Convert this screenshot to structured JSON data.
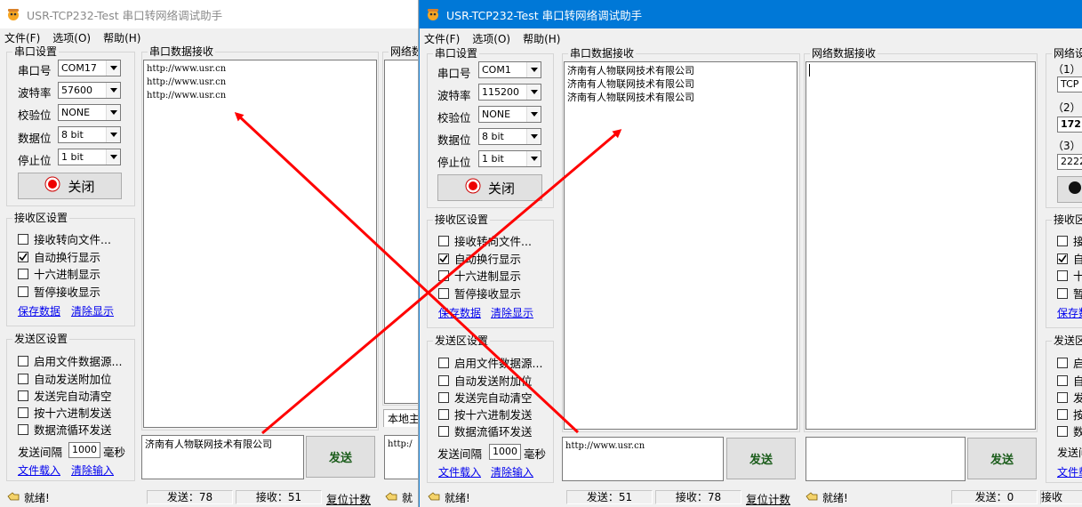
{
  "windowA": {
    "title": "USR-TCP232-Test 串口转网络调试助手",
    "menu": [
      "文件(F)",
      "选项(O)",
      "帮助(H)"
    ],
    "serial_group_title": "串口设置",
    "fields": [
      {
        "label": "串口号",
        "value": "COM17"
      },
      {
        "label": "波特率",
        "value": "57600"
      },
      {
        "label": "校验位",
        "value": "NONE"
      },
      {
        "label": "数据位",
        "value": "8 bit"
      },
      {
        "label": "停止位",
        "value": "1 bit"
      }
    ],
    "close_button": "关闭",
    "recv_group_title": "接收区设置",
    "recv_options": [
      {
        "label": "接收转向文件...",
        "checked": false
      },
      {
        "label": "自动换行显示",
        "checked": true
      },
      {
        "label": "十六进制显示",
        "checked": false
      },
      {
        "label": "暂停接收显示",
        "checked": false
      }
    ],
    "save_data": "保存数据",
    "clear_display": "清除显示",
    "send_group_title": "发送区设置",
    "send_options": [
      {
        "label": "启用文件数据源...",
        "checked": false
      },
      {
        "label": "自动发送附加位",
        "checked": false
      },
      {
        "label": "发送完自动清空",
        "checked": false
      },
      {
        "label": "按十六进制发送",
        "checked": false
      },
      {
        "label": "数据流循环发送",
        "checked": false
      }
    ],
    "interval_label": "发送间隔",
    "interval_value": "1000",
    "interval_unit": "毫秒",
    "load_file": "文件载入",
    "clear_input": "清除输入",
    "serial_recv_title": "串口数据接收",
    "serial_recv_lines": [
      "http://www.usr.cn",
      "http://www.usr.cn",
      "http://www.usr.cn"
    ],
    "send_text": "济南有人物联网技术有限公司",
    "send_button": "发送",
    "net_recv_title_frag": "网络数",
    "local_tab_frag": "本地主",
    "net_send_frag": "http:/",
    "status_ready": "就绪!",
    "status_send": "发送：78",
    "status_recv": "接收：51",
    "reset_count": "复位计数",
    "status_frag": "就"
  },
  "windowB": {
    "title": "USR-TCP232-Test 串口转网络调试助手",
    "menu": [
      "文件(F)",
      "选项(O)",
      "帮助(H)"
    ],
    "serial_group_title": "串口设置",
    "fields": [
      {
        "label": "串口号",
        "value": "COM1"
      },
      {
        "label": "波特率",
        "value": "115200"
      },
      {
        "label": "校验位",
        "value": "NONE"
      },
      {
        "label": "数据位",
        "value": "8 bit"
      },
      {
        "label": "停止位",
        "value": "1 bit"
      }
    ],
    "close_button": "关闭",
    "recv_group_title": "接收区设置",
    "recv_options": [
      {
        "label": "接收转向文件...",
        "checked": false
      },
      {
        "label": "自动换行显示",
        "checked": true
      },
      {
        "label": "十六进制显示",
        "checked": false
      },
      {
        "label": "暂停接收显示",
        "checked": false
      }
    ],
    "save_data": "保存数据",
    "clear_display": "清除显示",
    "send_group_title": "发送区设置",
    "send_options": [
      {
        "label": "启用文件数据源...",
        "checked": false
      },
      {
        "label": "自动发送附加位",
        "checked": false
      },
      {
        "label": "发送完自动清空",
        "checked": false
      },
      {
        "label": "按十六进制发送",
        "checked": false
      },
      {
        "label": "数据流循环发送",
        "checked": false
      }
    ],
    "interval_label": "发送间隔",
    "interval_value": "1000",
    "interval_unit": "毫秒",
    "load_file": "文件载入",
    "clear_input": "清除输入",
    "serial_recv_title": "串口数据接收",
    "serial_recv_lines": [
      "济南有人物联网技术有限公司",
      "济南有人物联网技术有限公司",
      "济南有人物联网技术有限公司"
    ],
    "serial_send_text": "http://www.usr.cn",
    "send_button": "发送",
    "net_recv_title": "网络数据接收",
    "net_send_button": "发送",
    "status_ready": "就绪!",
    "status_send": "发送：51",
    "status_recv": "接收：78",
    "reset_count": "复位计数",
    "status_ready2": "就绪!",
    "status_send2": "发送：0",
    "status_recv_frag": "接收",
    "net_settings_frag": "网络设",
    "net_param1": "（1）",
    "net_proto_frag": "TCP",
    "net_param2": "（2）",
    "net_ip_frag": "172",
    "net_param3": "（3）",
    "net_port_frag": "2222",
    "right_recv_frag": "接收区",
    "right_recv_items": [
      "接",
      "自",
      "十",
      "暂"
    ],
    "right_save_frag": "保存数",
    "right_send_frag": "发送区",
    "right_send_items": [
      "启",
      "自",
      "发",
      "按",
      "数"
    ],
    "right_interval_frag": "发送间",
    "right_file_frag": "文件载"
  },
  "colors": {
    "active_title": "#0078d7",
    "annotation": "#ff0000",
    "link": "#0000ee",
    "send_text": "#1a5c1a"
  }
}
